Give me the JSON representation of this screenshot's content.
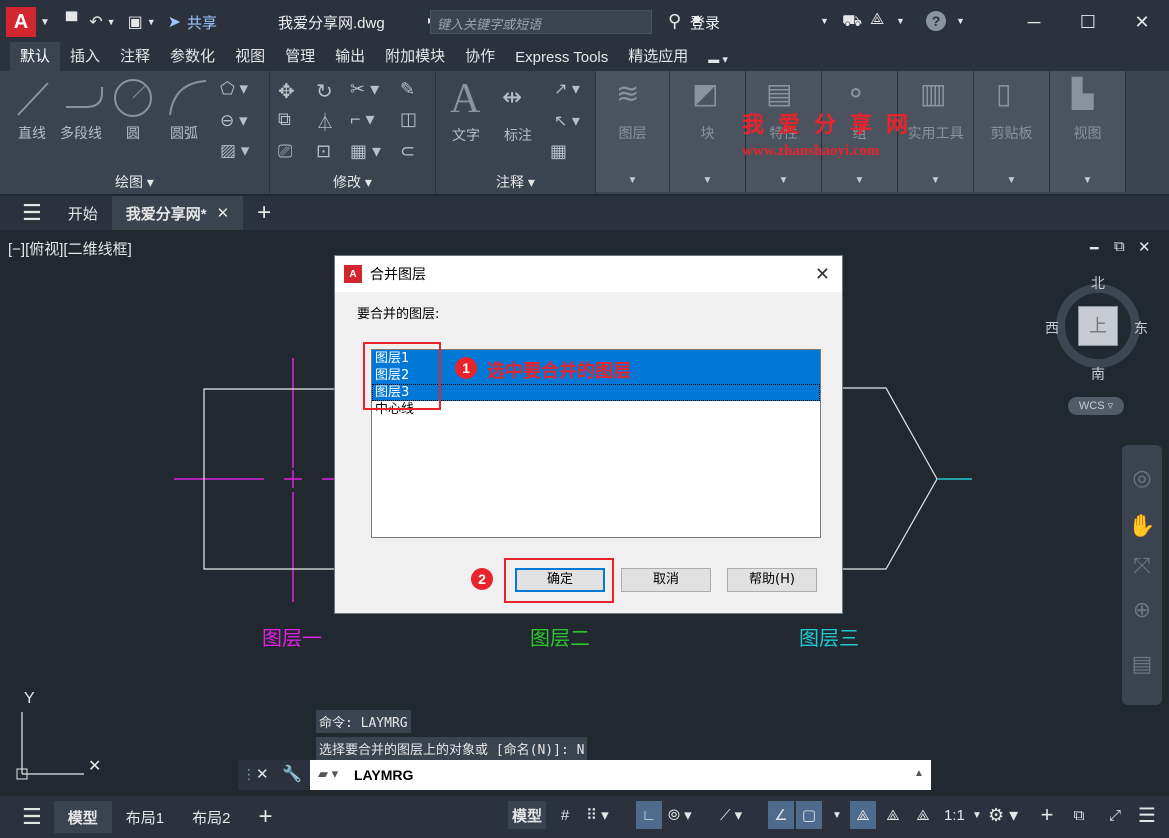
{
  "title_bar": {
    "app_logo": "A",
    "share_label": "共享",
    "file_name": "我爱分享网.dwg",
    "search_placeholder": "键入关键字或短语",
    "login_label": "登录"
  },
  "ribbon_tabs": [
    "默认",
    "插入",
    "注释",
    "参数化",
    "视图",
    "管理",
    "输出",
    "附加模块",
    "协作",
    "Express Tools",
    "精选应用"
  ],
  "ribbon": {
    "draw_tools": {
      "line": "直线",
      "polyline": "多段线",
      "circle": "圆",
      "arc": "圆弧"
    },
    "draw_panel_title": "绘图 ▾",
    "modify_panel_title": "修改 ▾",
    "annotate_tools": {
      "text": "文字",
      "dimension": "标注"
    },
    "annotate_panel_title": "注释 ▾",
    "grey_panels": [
      "图层",
      "块",
      "特性",
      "组",
      "实用工具",
      "剪贴板",
      "视图"
    ]
  },
  "watermark": {
    "title": "我爱分享网",
    "url": "www.zhanshaoyi.com"
  },
  "file_tabs": {
    "home": "开始",
    "current": "我爱分享网*"
  },
  "viewport_label": "[−][俯视][二维线框]",
  "drawing_labels": {
    "layer1": "图层一",
    "layer2": "图层二",
    "layer3": "图层三"
  },
  "dialog": {
    "title": "合并图层",
    "prompt": "要合并的图层:",
    "layers": [
      {
        "name": "图层1",
        "selected": true
      },
      {
        "name": "图层2",
        "selected": true
      },
      {
        "name": "图层3",
        "selected": true
      },
      {
        "name": "中心线",
        "selected": false
      }
    ],
    "buttons": {
      "ok": "确定",
      "cancel": "取消",
      "help": "帮助(H)"
    },
    "annotation_step1": "选中要合并的图层",
    "step1": "1",
    "step2": "2"
  },
  "viewcube": {
    "north": "北",
    "south": "南",
    "east": "东",
    "west": "西",
    "top": "上",
    "wcs": "WCS ▿"
  },
  "command": {
    "history": [
      "命令: LAYMRG",
      "选择要合并的图层上的对象或 [命名(N)]: N"
    ],
    "input": "LAYMRG"
  },
  "status_tabs": {
    "model": "模型",
    "layout1": "布局1",
    "layout2": "布局2"
  },
  "status_right": {
    "model_label": "模型",
    "scale": "1:1"
  },
  "colors": {
    "magenta": "#e020e0",
    "green": "#2ec42e",
    "cyan": "#22c8d0",
    "accent_red": "#e8232b",
    "selection_blue": "#0078d7"
  }
}
